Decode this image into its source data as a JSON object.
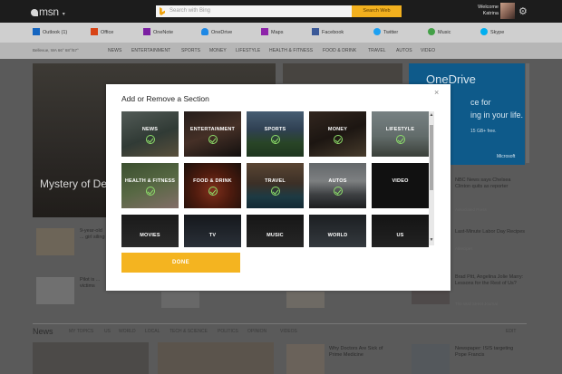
{
  "header": {
    "logo": "msn",
    "search_placeholder": "Search with Bing",
    "search_button": "Search Web",
    "welcome_line1": "Welcome",
    "welcome_line2": "Katrina"
  },
  "apps": [
    {
      "label": "Outlook (1)",
      "color": "#1565c0"
    },
    {
      "label": "Office",
      "color": "#d84315"
    },
    {
      "label": "OneNote",
      "color": "#7b1fa2"
    },
    {
      "label": "OneDrive",
      "color": "#1e88e5"
    },
    {
      "label": "Maps",
      "color": "#8e24aa"
    },
    {
      "label": "Facebook",
      "color": "#3b5998"
    },
    {
      "label": "Twitter",
      "color": "#1da1f2"
    },
    {
      "label": "Music",
      "color": "#43a047"
    },
    {
      "label": "Skype",
      "color": "#00aff0"
    }
  ],
  "nav": {
    "location": "Bellevue, WA   66°  68°/57°",
    "items": [
      "NEWS",
      "ENTERTAINMENT",
      "SPORTS",
      "MONEY",
      "LIFESTYLE",
      "HEALTH & FITNESS",
      "FOOD & DRINK",
      "TRAVEL",
      "AUTOS",
      "VIDEO"
    ]
  },
  "background": {
    "hero_title": "Mystery of De",
    "ad_title": "OneDrive",
    "ad_lines": [
      "ce for",
      "ing in your life."
    ],
    "ad_small": "15 GB+ free.",
    "ad_brand": "Microsoft",
    "side_items": [
      {
        "text": "NBC News says Chelsea Clinton quits as reporter",
        "source": "Associated Press"
      },
      {
        "text": "Last-Minute Labor Day Recipes",
        "source": "Allrecipes"
      },
      {
        "text": "Brad Pitt, Angelina Jolie Marry: Lessons for the Rest of Us?",
        "source": "The Wall Street Journal"
      }
    ],
    "row_texts": [
      "9-year-old ... girl siling",
      "Pilot is ... victims"
    ],
    "news_section": {
      "title": "News",
      "items": [
        "MY TOPICS",
        "US",
        "WORLD",
        "LOCAL",
        "TECH & SCIENCE",
        "POLITICS",
        "OPINION",
        "VIDEOS"
      ],
      "edit": "EDIT",
      "bottom": [
        "Why Doctors Are Sick of Prime Medicine",
        "Newspaper: ISIS targeting Pope Francis"
      ]
    }
  },
  "modal": {
    "title": "Add or Remove a Section",
    "close": "×",
    "done": "DONE",
    "tiles": [
      {
        "label": "NEWS",
        "checked": true
      },
      {
        "label": "ENTERTAINMENT",
        "checked": true
      },
      {
        "label": "SPORTS",
        "checked": true
      },
      {
        "label": "MONEY",
        "checked": true
      },
      {
        "label": "LIFESTYLE",
        "checked": true
      },
      {
        "label": "HEALTH & FITNESS",
        "checked": true
      },
      {
        "label": "FOOD & DRINK",
        "checked": true
      },
      {
        "label": "TRAVEL",
        "checked": true
      },
      {
        "label": "AUTOS",
        "checked": true
      },
      {
        "label": "VIDEO",
        "checked": false
      },
      {
        "label": "MOVIES",
        "checked": false
      },
      {
        "label": "TV",
        "checked": false
      },
      {
        "label": "MUSIC",
        "checked": false
      },
      {
        "label": "WORLD",
        "checked": false
      },
      {
        "label": "US",
        "checked": false
      }
    ]
  }
}
